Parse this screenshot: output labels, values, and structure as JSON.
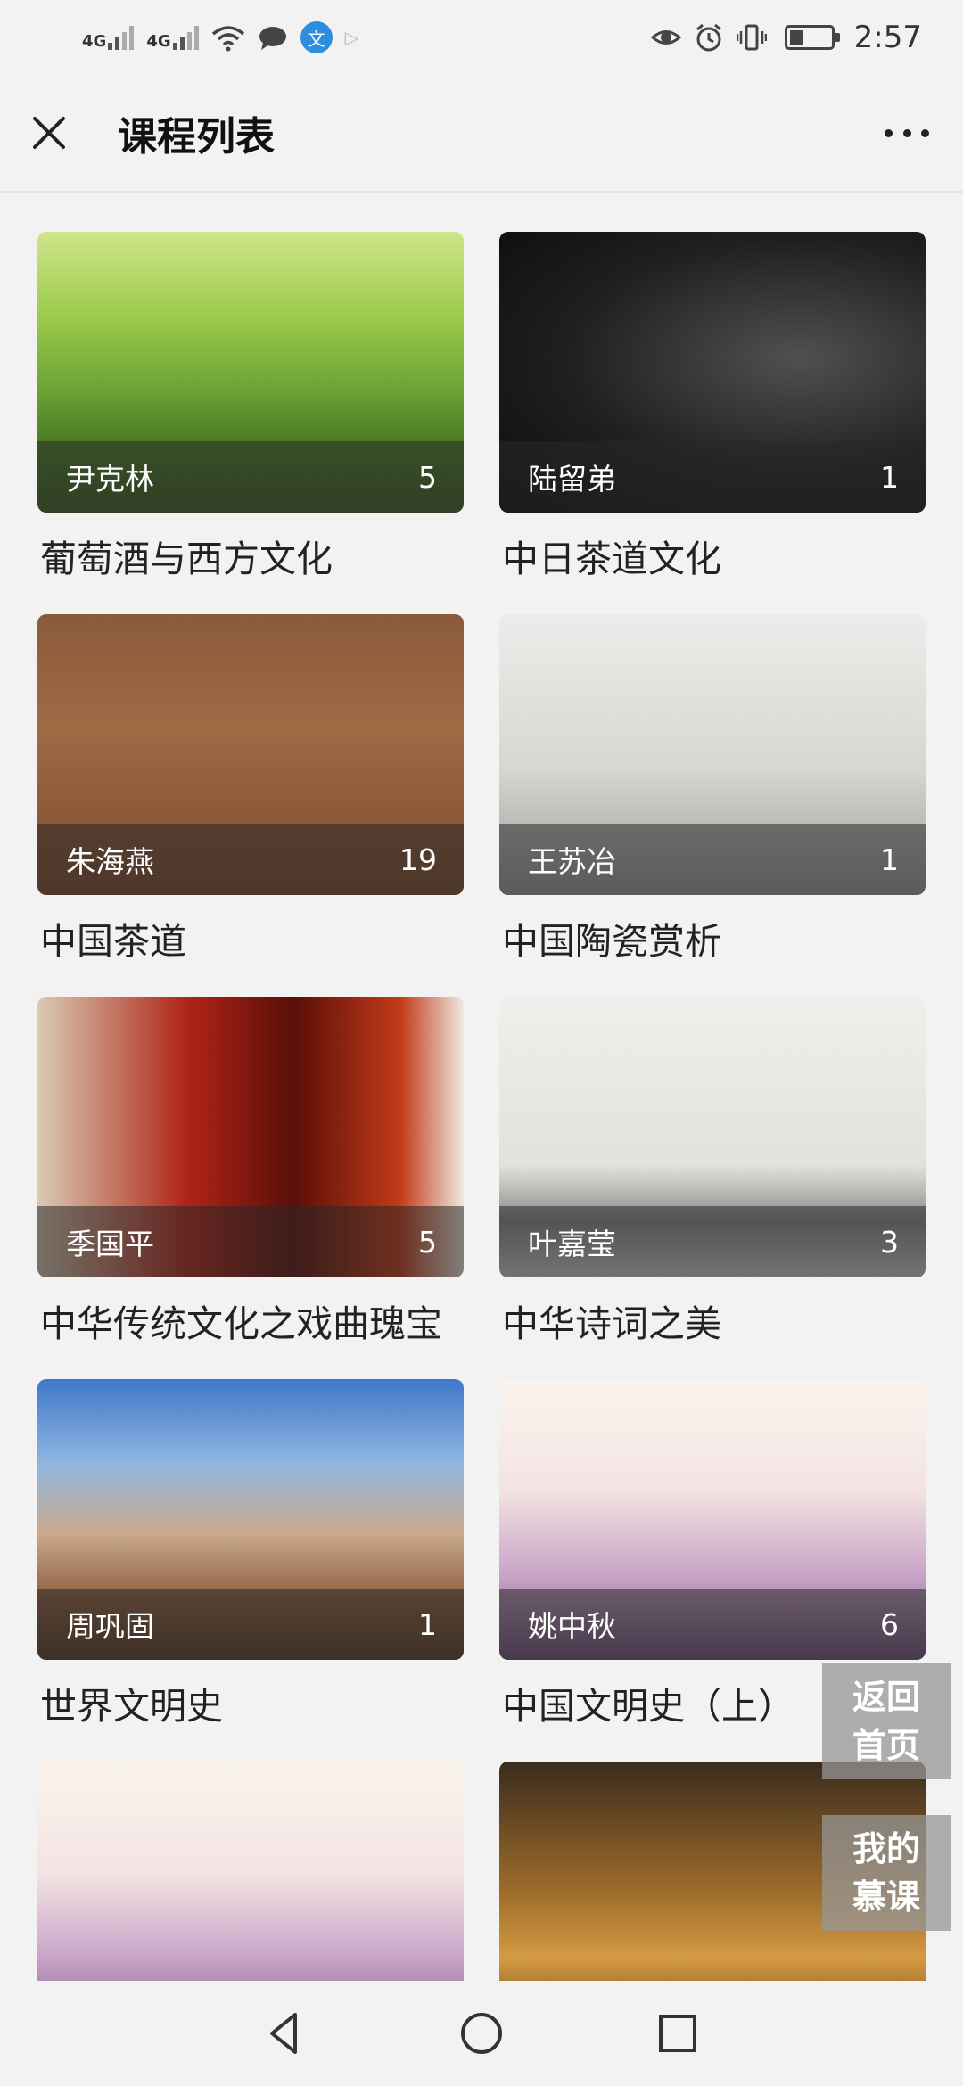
{
  "status_bar": {
    "network1": "4G",
    "network2": "4G",
    "app_glyph": "文",
    "time": "2:57",
    "icons": [
      "signal-icon",
      "wifi-icon",
      "chat-icon",
      "app-icon",
      "eye-icon",
      "alarm-icon",
      "vibrate-icon",
      "battery-icon"
    ]
  },
  "header": {
    "title": "课程列表",
    "close_icon": "close-icon",
    "more_icon": "more-icon"
  },
  "courses": [
    {
      "teacher": "尹克林",
      "count": "5",
      "title": "葡萄酒与西方文化",
      "art": "art-wine"
    },
    {
      "teacher": "陆留弟",
      "count": "1",
      "title": "中日茶道文化",
      "art": "art-tea1"
    },
    {
      "teacher": "朱海燕",
      "count": "19",
      "title": "中国茶道",
      "art": "art-tea2"
    },
    {
      "teacher": "王苏冶",
      "count": "1",
      "title": "中国陶瓷赏析",
      "art": "art-china"
    },
    {
      "teacher": "季国平",
      "count": "5",
      "title": "中华传统文化之戏曲瑰宝",
      "art": "art-opera"
    },
    {
      "teacher": "叶嘉莹",
      "count": "3",
      "title": "中华诗词之美",
      "art": "art-poem"
    },
    {
      "teacher": "周巩固",
      "count": "1",
      "title": "世界文明史",
      "art": "art-maya"
    },
    {
      "teacher": "姚中秋",
      "count": "6",
      "title": "中国文明史（上）",
      "art": "art-ink"
    },
    {
      "teacher": "",
      "count": "",
      "title": "",
      "art": "art-ink"
    },
    {
      "teacher": "",
      "count": "",
      "title": "",
      "art": "art-ruin"
    }
  ],
  "float_buttons": {
    "home_line1": "返回",
    "home_line2": "首页",
    "mine_line1": "我的",
    "mine_line2": "慕课"
  },
  "nav_bar": {
    "back": "back-icon",
    "home": "home-icon",
    "recents": "recents-icon"
  }
}
